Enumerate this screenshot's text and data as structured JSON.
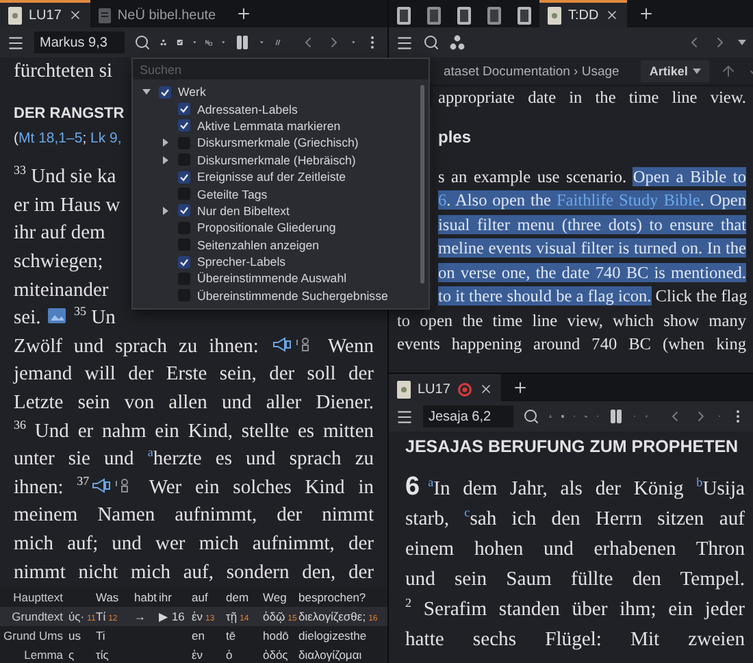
{
  "left_pane": {
    "tabs": [
      {
        "label": "LU17",
        "selected": true,
        "closable": true
      },
      {
        "label": "NeÜ bibel.heute",
        "selected": false,
        "closable": false
      }
    ],
    "reference": "Markus 9,3",
    "lines": [
      {
        "kind": "partial",
        "segments": [
          {
            "kind": "text",
            "text": "fürchteten si"
          }
        ]
      },
      {
        "kind": "heading",
        "segments": [
          {
            "kind": "text",
            "text": "DER RANGSTR"
          }
        ]
      },
      {
        "kind": "references",
        "segments": [
          {
            "kind": "text",
            "text": "("
          },
          {
            "kind": "link",
            "text": "Mt 18,1–5"
          },
          {
            "kind": "text",
            "text": "; "
          },
          {
            "kind": "link",
            "text": "Lk 9,"
          }
        ]
      },
      {
        "kind": "paragraph",
        "segments": [
          {
            "kind": "text",
            "text": "$^{33}$ Und sie ka"
          }
        ]
      },
      {
        "kind": "partial",
        "segments": [
          {
            "kind": "text",
            "text": "er im Haus w"
          }
        ]
      },
      {
        "kind": "partial",
        "segments": [
          {
            "kind": "text",
            "text": "ihr auf dem"
          }
        ]
      },
      {
        "kind": "partial",
        "segments": [
          {
            "kind": "text",
            "text": "schwiegen;"
          }
        ]
      },
      {
        "kind": "partial",
        "segments": [
          {
            "kind": "text",
            "text": "miteinander"
          }
        ]
      },
      {
        "kind": "partial",
        "segments": [
          {
            "kind": "text",
            "text": "sei. "
          },
          {
            "kind": "media-link"
          },
          {
            "kind": "text",
            "text": " $^{35}$ Un"
          }
        ]
      },
      {
        "kind": "full",
        "segments": [
          {
            "kind": "text",
            "text": "Zwölf und sprach zu ihnen: "
          },
          {
            "kind": "speaker-label"
          },
          {
            "kind": "text",
            "text": " Wenn"
          }
        ]
      },
      {
        "kind": "full",
        "segments": [
          {
            "kind": "text",
            "text": "jemand will der Erste sein, der soll der"
          }
        ]
      },
      {
        "kind": "full",
        "segments": [
          {
            "kind": "text",
            "text": "Letzte sein von allen und aller Diener."
          }
        ]
      },
      {
        "kind": "full",
        "segments": [
          {
            "kind": "text",
            "text": "$^{36}$ Und er nahm ein Kind, stellte es mitten"
          }
        ]
      },
      {
        "kind": "full",
        "segments": [
          {
            "kind": "text",
            "text": "unter sie und "
          },
          {
            "kind": "link",
            "text": "$^{a}$"
          },
          {
            "kind": "text",
            "text": "herzte es und sprach zu"
          }
        ]
      },
      {
        "kind": "full",
        "segments": [
          {
            "kind": "text",
            "text": "ihnen: $^{37}$"
          },
          {
            "kind": "speaker-label"
          },
          {
            "kind": "text",
            "text": " Wer ein solches Kind in"
          }
        ]
      },
      {
        "kind": "full",
        "segments": [
          {
            "kind": "text",
            "text": "meinem Namen aufnimmt, der nimmt"
          }
        ]
      },
      {
        "kind": "full",
        "segments": [
          {
            "kind": "text",
            "text": "mich auf; und wer mich aufnimmt, der"
          }
        ]
      },
      {
        "kind": "full",
        "segments": [
          {
            "kind": "text",
            "text": "nimmt nicht mich auf, sondern den, der"
          }
        ]
      }
    ],
    "interlinear": {
      "rows": [
        {
          "label": "Haupttext",
          "selected": false,
          "cells": [
            null,
            {
              "text": "Was"
            },
            {
              "text": "habt"
            },
            {
              "text": "ihr"
            },
            {
              "text": "auf"
            },
            {
              "text": "dem"
            },
            {
              "text": "Weg"
            },
            {
              "text": "besprochen?"
            }
          ]
        },
        {
          "label": "Grundtext",
          "selected": true,
          "cells": [
            {
              "text": "ύς·",
              "number": "11"
            },
            {
              "text": "Τί",
              "number": "12"
            },
            {
              "text": "→"
            },
            {
              "text": "▶ 16"
            },
            {
              "text": "ἐν",
              "number": "13"
            },
            {
              "text": "τῇ",
              "number": "14"
            },
            {
              "text": "ὁδῷ",
              "number": "15"
            },
            {
              "text": "διελογίζεσθε;",
              "number": "16"
            }
          ]
        },
        {
          "label": "Grund Ums",
          "selected": false,
          "cells": [
            {
              "text": "us"
            },
            {
              "text": "Ti"
            },
            null,
            null,
            {
              "text": "en"
            },
            {
              "text": "tē"
            },
            {
              "text": "hodō"
            },
            {
              "text": "dielogizesthe"
            }
          ]
        },
        {
          "label": "Lemma",
          "selected": false,
          "cells": [
            {
              "text": "ς"
            },
            {
              "text": "τίς"
            },
            null,
            null,
            {
              "text": "ἐν"
            },
            {
              "text": "ὁ"
            },
            {
              "text": "ὁδός"
            },
            {
              "text": "διαλογίζομαι"
            }
          ]
        }
      ]
    },
    "filter_menu": {
      "placeholder": "Suchen",
      "items": [
        {
          "label": "Werk",
          "checked": true,
          "expanded": true,
          "children": [
            {
              "label": "Adressaten-Labels",
              "checked": true
            },
            {
              "label": "Aktive Lemmata markieren",
              "checked": true
            },
            {
              "label": "Diskursmerkmale (Griechisch)",
              "checked": false,
              "expanded": false
            },
            {
              "label": "Diskursmerkmale (Hebräisch)",
              "checked": false,
              "expanded": false
            },
            {
              "label": "Ereignisse auf der Zeitleiste",
              "checked": true
            },
            {
              "label": "Geteilte Tags",
              "checked": false
            },
            {
              "label": "Nur den Bibeltext",
              "checked": true,
              "expanded": false
            },
            {
              "label": "Propositionale Gliederung",
              "checked": false
            },
            {
              "label": "Seitenzahlen anzeigen",
              "checked": false
            },
            {
              "label": "Sprecher-Labels",
              "checked": true
            },
            {
              "label": "Übereinstimmende Auswahl",
              "checked": false
            },
            {
              "label": "Übereinstimmende Suchergebnisse",
              "checked": false
            }
          ]
        }
      ]
    }
  },
  "right_top": {
    "tabs": [
      {
        "selected": false
      },
      {
        "selected": false
      },
      {
        "selected": false
      },
      {
        "selected": false
      },
      {
        "selected": false
      },
      {
        "label": "T:DD",
        "selected": true,
        "closable": true
      }
    ],
    "breadcrumb": "ataset Documentation › Usage",
    "view_menu": "Artikel",
    "lines": [
      {
        "kind": "cut",
        "segments": [
          {
            "kind": "text",
            "text": "appropriate date in the time line view."
          }
        ]
      },
      {
        "kind": "cut-heading",
        "segments": [
          {
            "kind": "text",
            "text": "ples"
          }
        ]
      },
      {
        "kind": "cut",
        "segments": [
          {
            "kind": "text",
            "text": "s an example use scenario. "
          },
          {
            "kind": "text",
            "text": "Open a Bible to",
            "highlighted": true
          }
        ]
      },
      {
        "kind": "cut",
        "segments": [
          {
            "kind": "link",
            "text": "6",
            "highlighted": true
          },
          {
            "kind": "text",
            "text": ". Also open the ",
            "highlighted": true
          },
          {
            "kind": "link",
            "text": "Faithlife Study Bible",
            "highlighted": true
          },
          {
            "kind": "text",
            "text": ". Open",
            "highlighted": true
          }
        ]
      },
      {
        "kind": "cut",
        "segments": [
          {
            "kind": "text",
            "text": "isual filter menu (three dots) to ensure that",
            "highlighted": true
          }
        ]
      },
      {
        "kind": "cut",
        "segments": [
          {
            "kind": "text",
            "text": "meline events visual filter is turned on. In the",
            "highlighted": true
          }
        ]
      },
      {
        "kind": "cut",
        "segments": [
          {
            "kind": "text",
            "text": "on verse one, the date 740 BC is mentioned.",
            "highlighted": true
          }
        ]
      },
      {
        "kind": "cut",
        "segments": [
          {
            "kind": "text",
            "text": "to it there should be a flag icon.",
            "highlighted": true
          },
          {
            "kind": "text",
            "text": " Click the flag"
          }
        ]
      },
      {
        "kind": "full",
        "segments": [
          {
            "kind": "text",
            "text": "to open the time line view, which show many"
          }
        ]
      },
      {
        "kind": "full",
        "segments": [
          {
            "kind": "text",
            "text": "events happening around 740 BC (when king"
          }
        ]
      }
    ]
  },
  "right_bottom": {
    "tabs": [
      {
        "label": "LU17",
        "selected": true,
        "closable": true,
        "linked": true
      }
    ],
    "reference": "Jesaja 6,2",
    "lines": [
      {
        "kind": "heading",
        "segments": [
          {
            "kind": "text",
            "text": "JESAJAS BERUFUNG ZUM PROPHETEN"
          }
        ]
      },
      {
        "kind": "full",
        "segments": [
          {
            "kind": "chapter",
            "text": "6"
          },
          {
            "kind": "link",
            "text": "$^{a}$"
          },
          {
            "kind": "text",
            "text": "In dem Jahr, als der König "
          },
          {
            "kind": "link",
            "text": "$^{b}$"
          },
          {
            "kind": "text",
            "text": "Usija"
          }
        ]
      },
      {
        "kind": "full",
        "segments": [
          {
            "kind": "text",
            "text": "starb, "
          },
          {
            "kind": "link",
            "text": "$^{c}$"
          },
          {
            "kind": "text",
            "text": "sah ich den Herrn sitzen auf"
          }
        ]
      },
      {
        "kind": "full",
        "segments": [
          {
            "kind": "text",
            "text": "einem hohen und erhabenen Thron"
          }
        ]
      },
      {
        "kind": "full",
        "segments": [
          {
            "kind": "text",
            "text": "und sein Saum füllte den Tempel."
          }
        ]
      },
      {
        "kind": "full",
        "segments": [
          {
            "kind": "text",
            "text": "$^{2}$ Serafim standen über ihm; ein jeder"
          }
        ]
      },
      {
        "kind": "full",
        "segments": [
          {
            "kind": "text",
            "text": "hatte sechs Flügel: Mit zweien"
          }
        ]
      }
    ]
  }
}
